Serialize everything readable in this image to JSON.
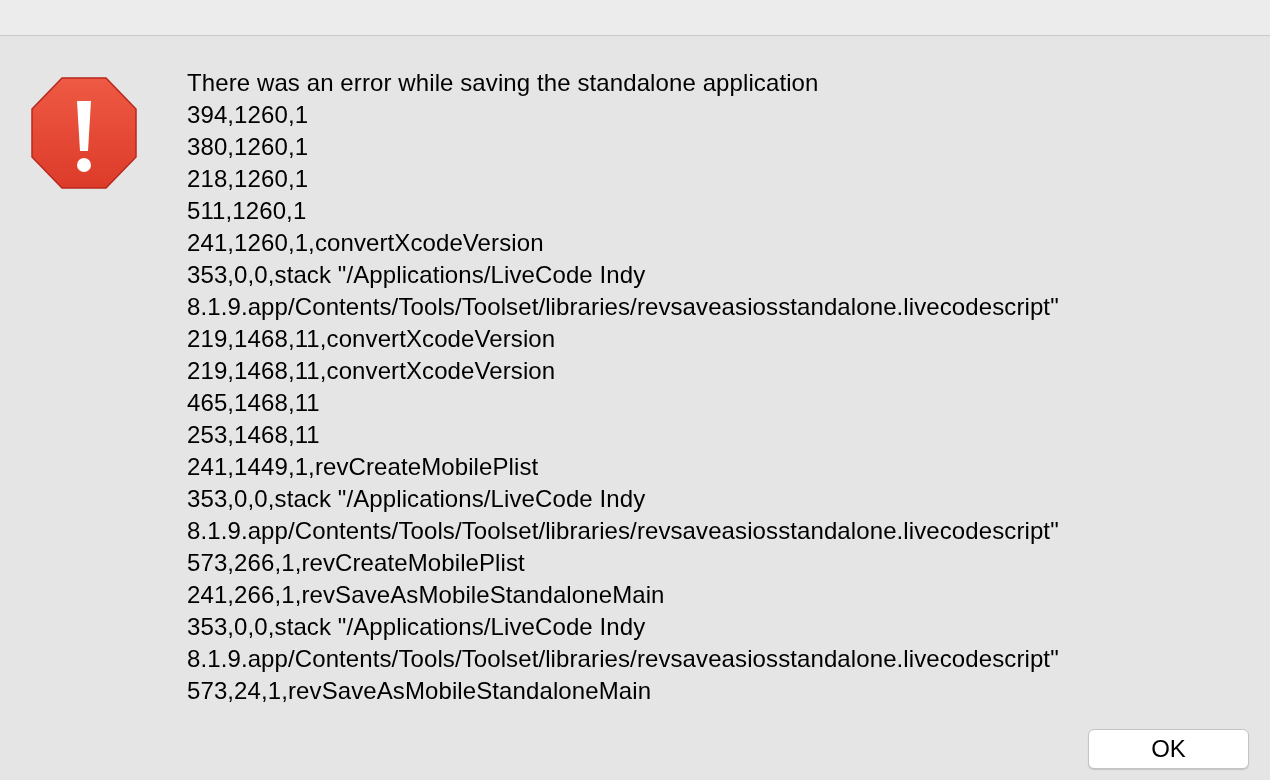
{
  "alert": {
    "kind": "error",
    "lines": [
      "There was an error while saving the standalone application",
      "394,1260,1",
      "380,1260,1",
      "218,1260,1",
      "511,1260,1",
      "241,1260,1,convertXcodeVersion",
      "353,0,0,stack \"/Applications/LiveCode Indy",
      "8.1.9.app/Contents/Tools/Toolset/libraries/revsaveasiosstandalone.livecodescript\"",
      "219,1468,11,convertXcodeVersion",
      "219,1468,11,convertXcodeVersion",
      "465,1468,11",
      "253,1468,11",
      "241,1449,1,revCreateMobilePlist",
      "353,0,0,stack \"/Applications/LiveCode Indy",
      "8.1.9.app/Contents/Tools/Toolset/libraries/revsaveasiosstandalone.livecodescript\"",
      "573,266,1,revCreateMobilePlist",
      "241,266,1,revSaveAsMobileStandaloneMain",
      "353,0,0,stack \"/Applications/LiveCode Indy",
      "8.1.9.app/Contents/Tools/Toolset/libraries/revsaveasiosstandalone.livecodescript\"",
      "573,24,1,revSaveAsMobileStandaloneMain"
    ],
    "buttons": [
      "OK"
    ]
  }
}
